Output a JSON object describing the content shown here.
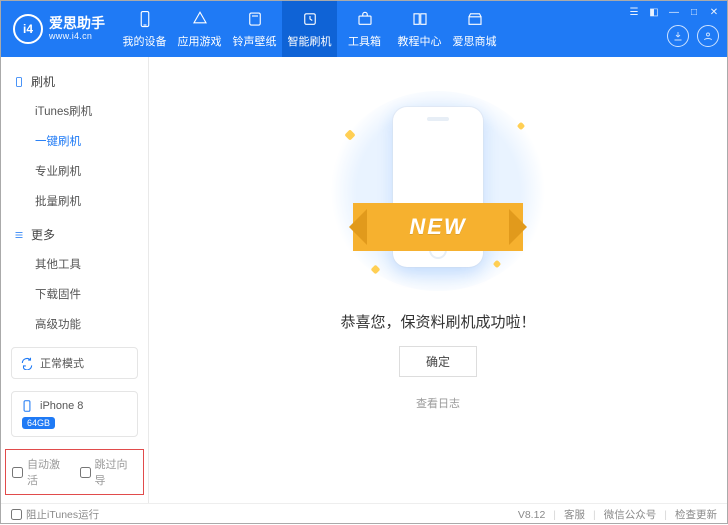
{
  "brand": {
    "badge": "i4",
    "title": "爱思助手",
    "subtitle": "www.i4.cn"
  },
  "nav": [
    {
      "label": "我的设备"
    },
    {
      "label": "应用游戏"
    },
    {
      "label": "铃声壁纸"
    },
    {
      "label": "智能刷机"
    },
    {
      "label": "工具箱"
    },
    {
      "label": "教程中心"
    },
    {
      "label": "爱思商城"
    }
  ],
  "sidebar": {
    "group1": {
      "title": "刷机",
      "items": [
        "iTunes刷机",
        "一键刷机",
        "专业刷机",
        "批量刷机"
      ]
    },
    "group2": {
      "title": "更多",
      "items": [
        "其他工具",
        "下载固件",
        "高级功能"
      ]
    }
  },
  "mode": {
    "label": "正常模式"
  },
  "device": {
    "name": "iPhone 8",
    "storage": "64GB"
  },
  "options": {
    "auto_activate": "自动激活",
    "skip_guide": "跳过向导"
  },
  "main": {
    "ribbon": "NEW",
    "message": "恭喜您，保资料刷机成功啦！",
    "ok": "确定",
    "view_log": "查看日志"
  },
  "status": {
    "block_itunes": "阻止iTunes运行",
    "version": "V8.12",
    "support": "客服",
    "wechat": "微信公众号",
    "check_update": "检查更新"
  }
}
